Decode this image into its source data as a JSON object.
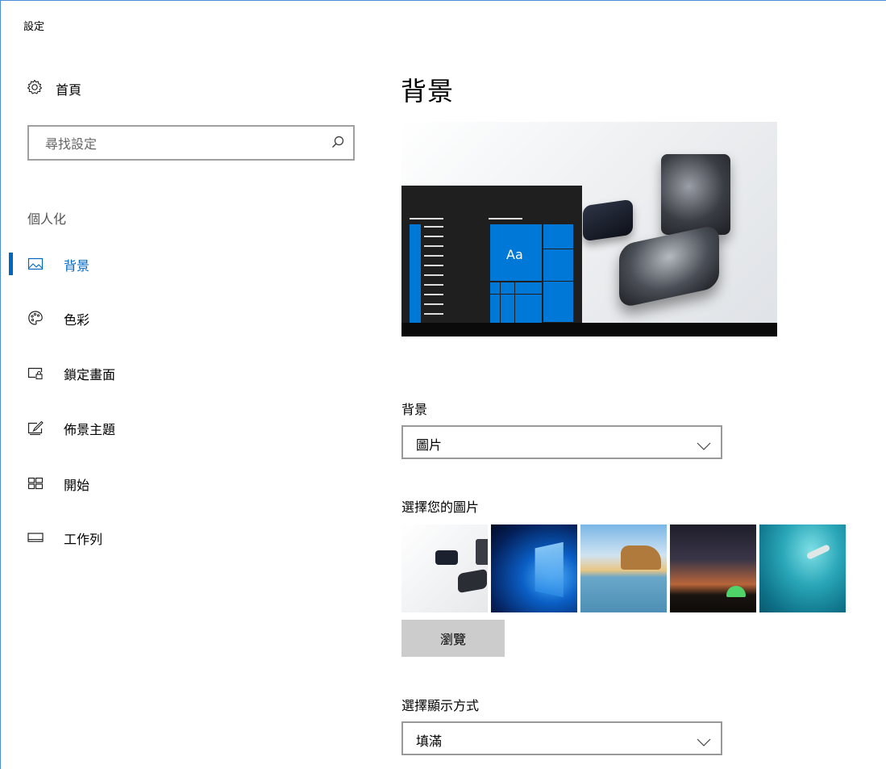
{
  "window": {
    "title": "設定"
  },
  "sidebar": {
    "home_label": "首頁",
    "search_placeholder": "尋找設定",
    "section_title": "個人化",
    "items": [
      {
        "label": "背景",
        "icon": "picture-icon",
        "active": true
      },
      {
        "label": "色彩",
        "icon": "palette-icon",
        "active": false
      },
      {
        "label": "鎖定畫面",
        "icon": "lock-screen-icon",
        "active": false
      },
      {
        "label": "佈景主題",
        "icon": "theme-icon",
        "active": false
      },
      {
        "label": "開始",
        "icon": "start-icon",
        "active": false
      },
      {
        "label": "工作列",
        "icon": "taskbar-icon",
        "active": false
      }
    ]
  },
  "main": {
    "title": "背景",
    "preview": {
      "tile_text": "Aa"
    },
    "background_label": "背景",
    "background_value": "圖片",
    "choose_picture_label": "選擇您的圖片",
    "browse_label": "瀏覽",
    "fit_label": "選擇顯示方式",
    "fit_value": "填滿"
  },
  "colors": {
    "accent": "#0067c0",
    "tile_blue": "#0078d7"
  }
}
